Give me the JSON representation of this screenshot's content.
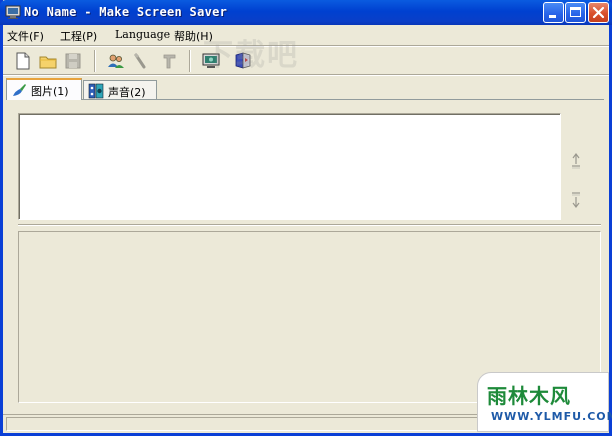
{
  "window": {
    "title": "No Name - Make Screen Saver"
  },
  "title_buttons": {
    "minimize": "minimize",
    "maximize": "maximize",
    "close": "close"
  },
  "menu": {
    "file": "文件(F)",
    "project": "工程(P)",
    "language": "Language",
    "help": "帮助(H)"
  },
  "toolbar": {
    "icons": [
      "new-file-icon",
      "open-folder-icon",
      "save-icon",
      "users-icon",
      "wand-icon",
      "tools-icon",
      "monitor-icon",
      "build-icon"
    ]
  },
  "tabs": [
    {
      "label": "图片(1)",
      "active": true
    },
    {
      "label": "声音(2)",
      "active": false
    }
  ],
  "side_buttons": {
    "up": "move-up",
    "down": "move-down"
  },
  "watermark": {
    "top_text": "下载吧",
    "badge_title": "雨林木风",
    "badge_url": "WWW.YLMFU.COM"
  },
  "colors": {
    "title_bar": "#0A5BE0",
    "window_face": "#ECE9D8",
    "close_button": "#D9502C",
    "tab_highlight": "#E8A33C"
  }
}
